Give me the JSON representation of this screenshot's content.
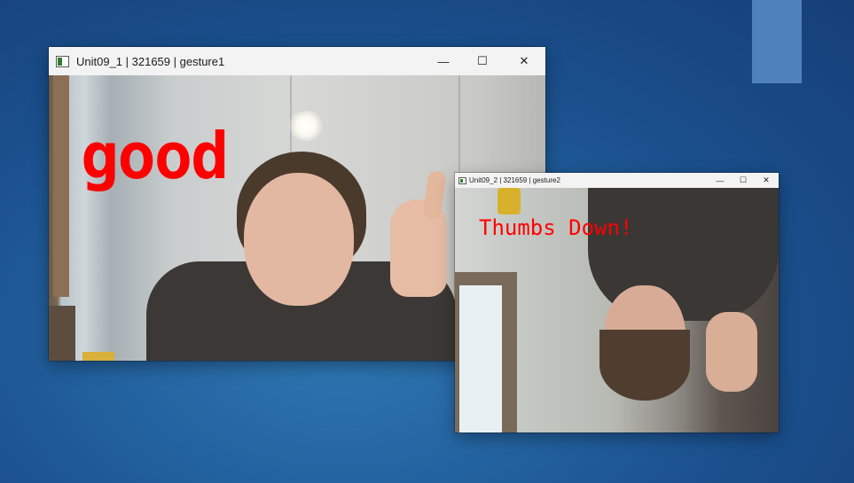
{
  "desktop": {
    "accent_color": "#4f81bd"
  },
  "window1": {
    "title": "Unit09_1 | 321659 | gesture1",
    "app_icon": "app-window-icon",
    "controls": {
      "minimize": "—",
      "maximize": "☐",
      "close": "✕"
    },
    "overlay_text": "good",
    "overlay_color": "#ff0000"
  },
  "window2": {
    "title": "Unit09_2 | 321659 | gesture2",
    "app_icon": "app-window-icon",
    "controls": {
      "minimize": "—",
      "maximize": "☐",
      "close": "✕"
    },
    "overlay_text": "Thumbs Down!",
    "overlay_color": "#ff0000"
  }
}
